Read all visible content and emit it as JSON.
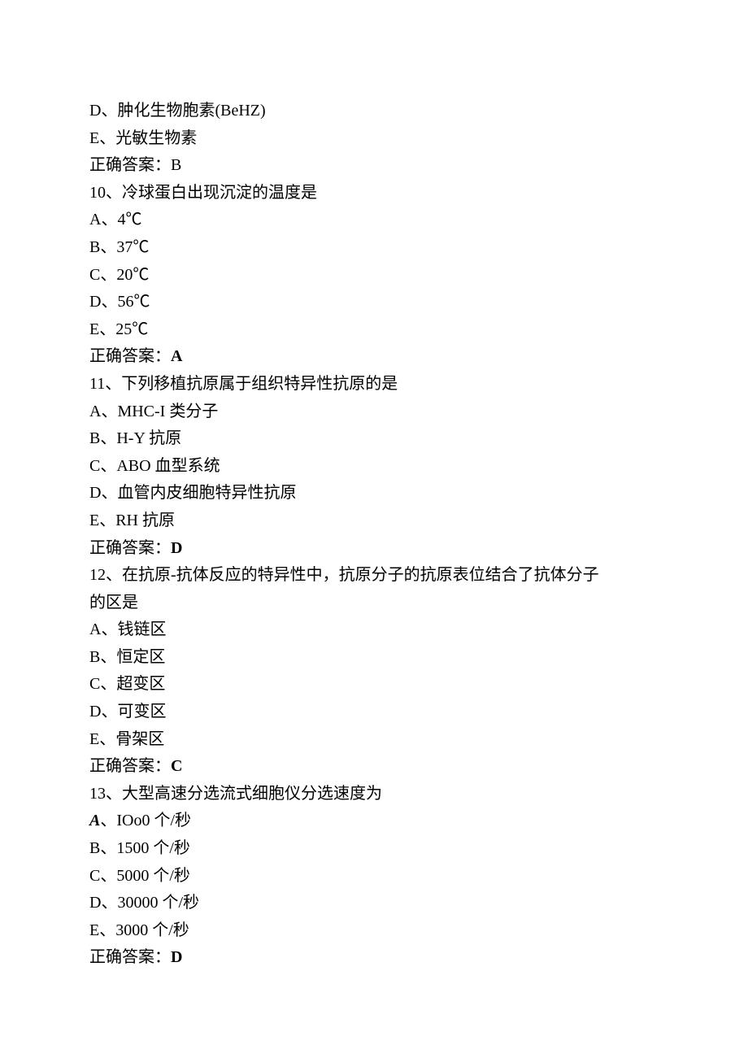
{
  "lines": {
    "l1": "D、肿化生物胞素(BeHZ)",
    "l2": "E、光敏生物素",
    "l3_label": "正确答案：",
    "l3_value": "B",
    "l4": "10、冷球蛋白出现沉淀的温度是",
    "l5": "A、4℃",
    "l6": "B、37℃",
    "l7": "C、20℃",
    "l8": "D、56℃",
    "l9": "E、25℃",
    "l10_label": "正确答案：",
    "l10_value": "A",
    "l11": "11、下列移植抗原属于组织特异性抗原的是",
    "l12": "A、MHC-I 类分子",
    "l13": "B、H-Y 抗原",
    "l14": "C、ABO 血型系统",
    "l15": "D、血管内皮细胞特异性抗原",
    "l16": "E、RH 抗原",
    "l17_label": "正确答案：",
    "l17_value": "D",
    "l18": "12、在抗原-抗体反应的特异性中，抗原分子的抗原表位结合了抗体分子",
    "l19": "的区是",
    "l20": "A、钱链区",
    "l21": "B、恒定区",
    "l22": "C、超变区",
    "l23": "D、可变区",
    "l24": "E、骨架区",
    "l25_label": "正确答案：",
    "l25_value": "C",
    "l26": "13、大型高速分选流式细胞仪分选速度为",
    "l27_prefix": "A",
    "l27_rest": "、IOo0 个/秒",
    "l28": "B、1500 个/秒",
    "l29": "C、5000 个/秒",
    "l30": "D、30000 个/秒",
    "l31": "E、3000 个/秒",
    "l32_label": "正确答案：",
    "l32_value": "D"
  }
}
